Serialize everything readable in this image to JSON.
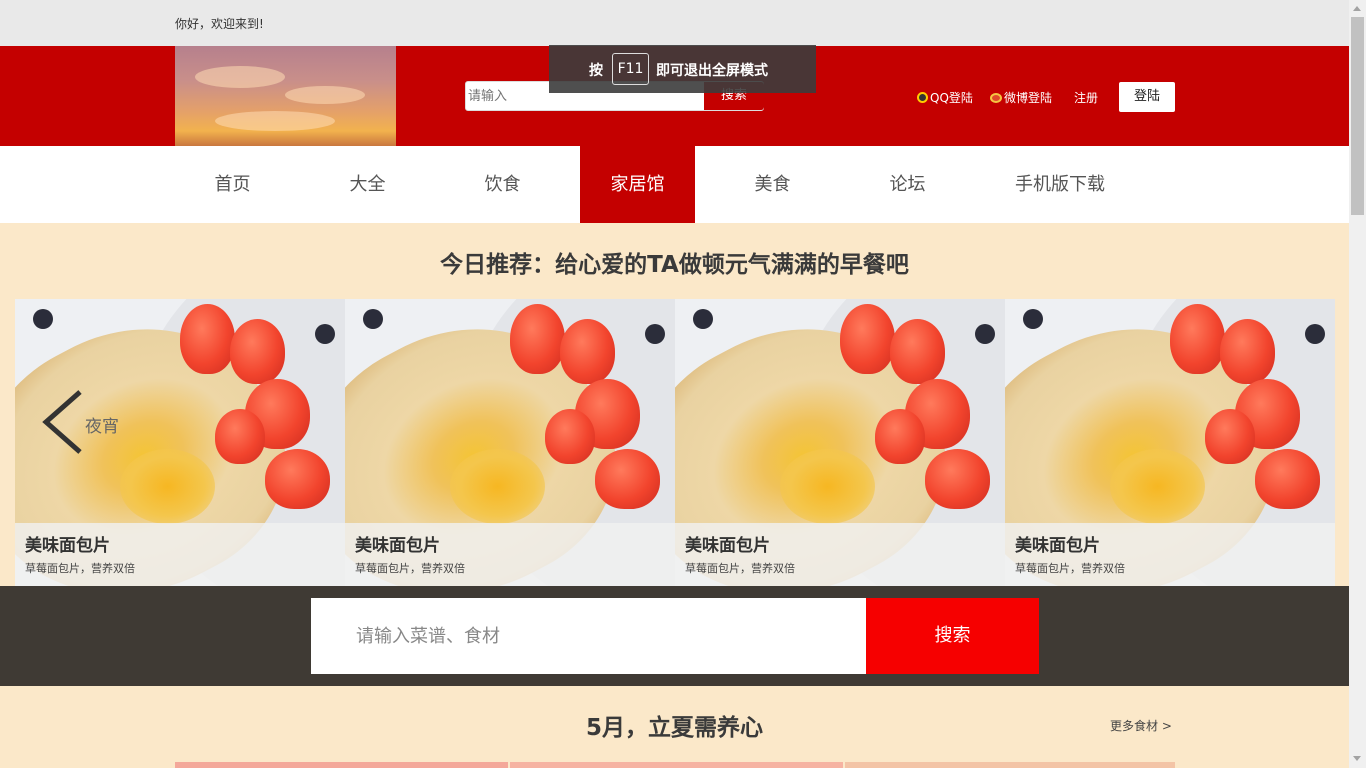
{
  "topbar": {
    "welcome": "你好，欢迎来到!"
  },
  "header": {
    "search_placeholder": "请输入",
    "search_button": "搜索",
    "qq_login": "QQ登陆",
    "weibo_login": "微博登陆",
    "register": "注册",
    "login_button": "登陆"
  },
  "fullscreen_notice": {
    "prefix": "按",
    "key": "F11",
    "suffix": "即可退出全屏模式"
  },
  "nav": {
    "items": [
      {
        "label": "首页"
      },
      {
        "label": "大全"
      },
      {
        "label": "饮食"
      },
      {
        "label": "家居馆",
        "active": true
      },
      {
        "label": "美食"
      },
      {
        "label": "论坛"
      },
      {
        "label": "手机版下载"
      }
    ]
  },
  "recommend": {
    "title": "今日推荐：给心爱的TA做顿元气满满的早餐吧",
    "prev_label": "夜宵",
    "cards": [
      {
        "title": "美味面包片",
        "desc": "草莓面包片，营养双倍"
      },
      {
        "title": "美味面包片",
        "desc": "草莓面包片，营养双倍"
      },
      {
        "title": "美味面包片",
        "desc": "草莓面包片，营养双倍"
      },
      {
        "title": "美味面包片",
        "desc": "草莓面包片，营养双倍"
      }
    ]
  },
  "big_search": {
    "placeholder": "请输入菜谱、食材",
    "button": "搜索"
  },
  "section": {
    "title": "5月，立夏需养心",
    "more": "更多食材 >"
  },
  "colors": {
    "brand_red": "#c40000",
    "search_red": "#f60000",
    "page_bg": "#fbe8c9",
    "dark_band": "#3f3a34"
  }
}
